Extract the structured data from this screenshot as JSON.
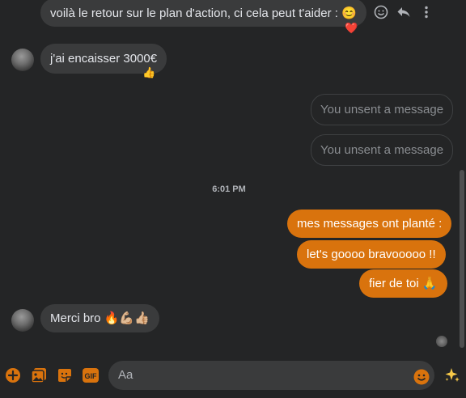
{
  "conversation": {
    "messages": [
      {
        "text": "voilà le retour sur le plan d'action, ci cela peut t'aider : 😊",
        "reaction": "❤️"
      },
      {
        "text": "j'ai encaisser 3000€",
        "reaction": "👍"
      },
      {
        "text": "You unsent a message"
      },
      {
        "text": "You unsent a message"
      },
      {
        "text": "mes messages ont planté :"
      },
      {
        "text": "let's goooo bravooooo !!"
      },
      {
        "text": "fier de toi 🙏"
      },
      {
        "text": "Merci bro 🔥💪🏼👍🏼"
      }
    ],
    "timestamp": "6:01 PM"
  },
  "composer": {
    "placeholder": "Aa"
  },
  "colors": {
    "accent": "#d9730d",
    "background": "#242526",
    "incoming_bubble": "#3a3b3c"
  },
  "icons": [
    "smile-icon",
    "reply-icon",
    "more-icon",
    "plus-icon",
    "image-icon",
    "sticker-icon",
    "gif-icon",
    "emoji-icon",
    "sparkle-icon"
  ]
}
